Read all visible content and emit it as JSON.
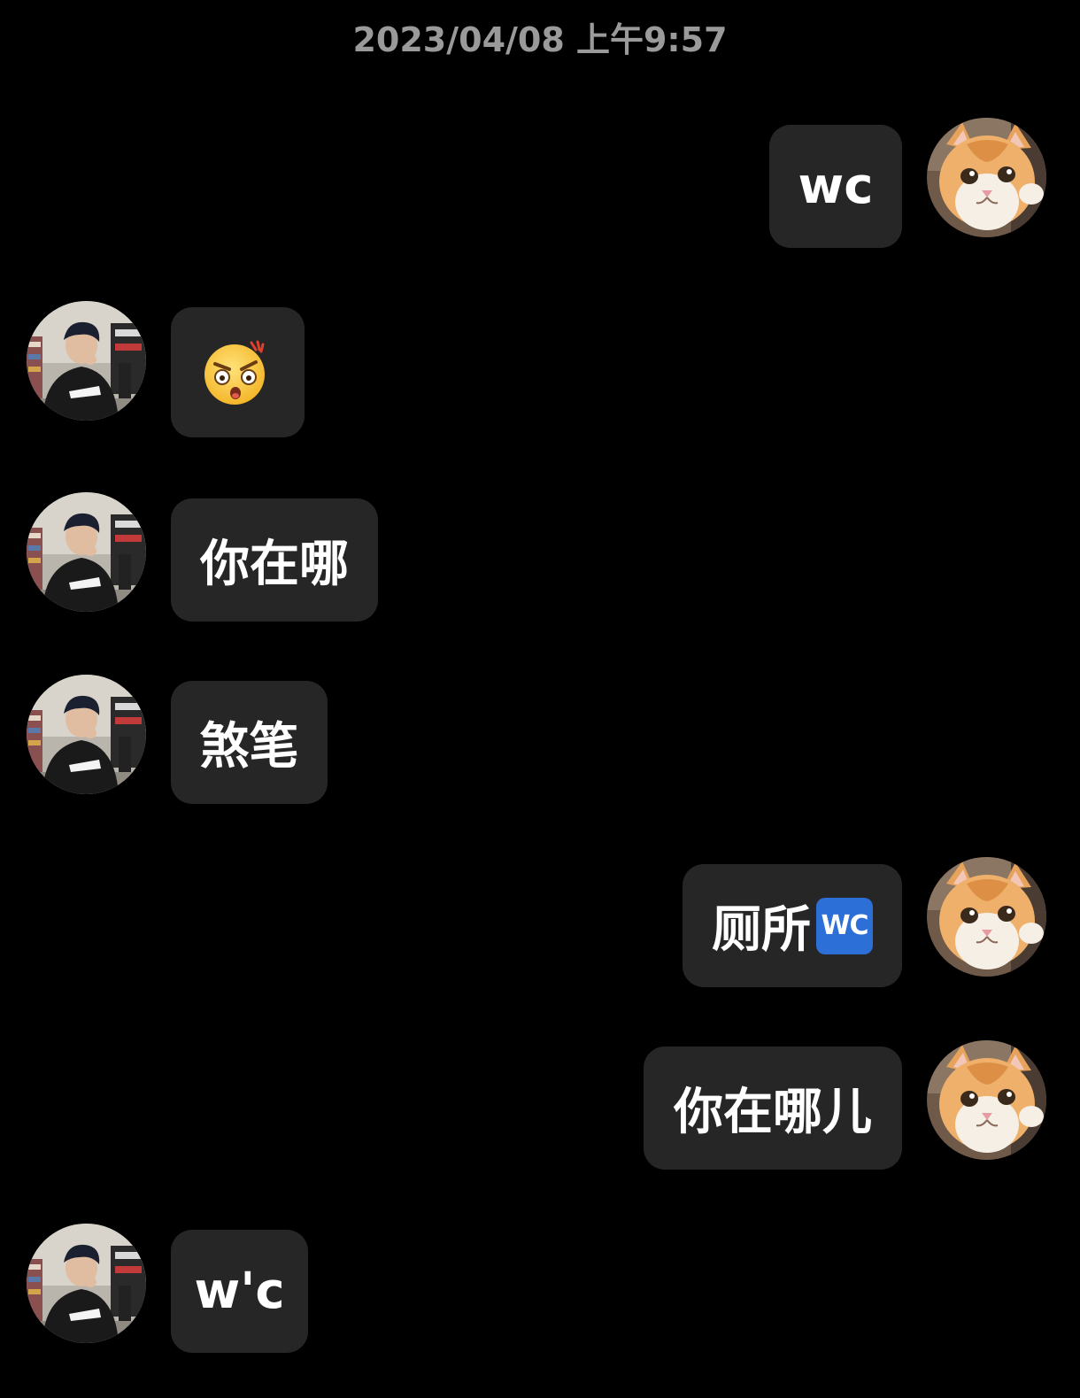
{
  "header": {
    "timestamp": "2023/04/08 上午9:57"
  },
  "messages": [
    {
      "side": "right",
      "sender": "me",
      "text": "wc"
    },
    {
      "side": "left",
      "sender": "friend",
      "emoji": "shocked-angry-face-emoji"
    },
    {
      "side": "left",
      "sender": "friend",
      "text": "你在哪"
    },
    {
      "side": "left",
      "sender": "friend",
      "text": "煞笔"
    },
    {
      "side": "right",
      "sender": "me",
      "text": "厕所",
      "badge": "WC"
    },
    {
      "side": "right",
      "sender": "me",
      "text": "你在哪儿"
    },
    {
      "side": "left",
      "sender": "friend",
      "text": "w'c"
    }
  ],
  "colors": {
    "background": "#000000",
    "bubble": "#262626",
    "timestamp": "#9a9a9a",
    "text": "#ffffff",
    "wc_badge": "#2c6fd6"
  },
  "icons": {
    "me_avatar": "cat-avatar",
    "friend_avatar": "person-avatar"
  }
}
